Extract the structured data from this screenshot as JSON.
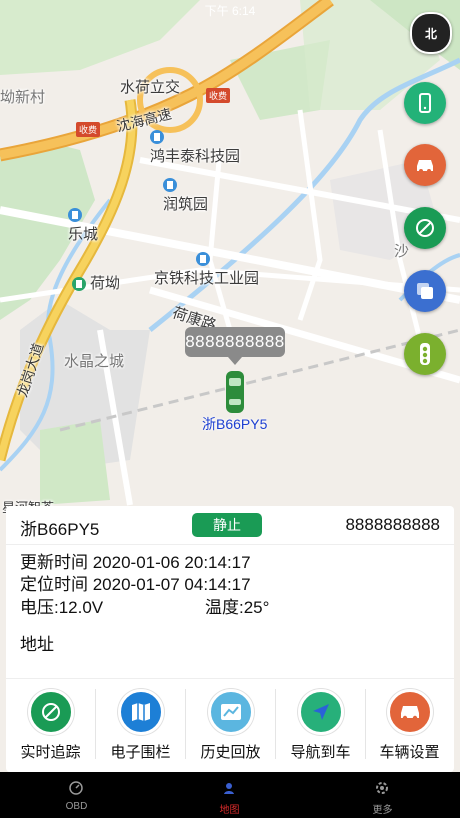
{
  "status_bar": {
    "time": "下午 6:14"
  },
  "map": {
    "labels": {
      "shuihe_interchange": "水荷立交",
      "shenhai_expressway": "沈海高速",
      "hongfengtai": "鸿丰泰科技园",
      "runzhuyuan": "润筑园",
      "lecheng": "乐城",
      "hegao": "荷坳",
      "jingtie": "京铁科技工业园",
      "hekang_road": "荷康路",
      "shuijing_city": "水晶之城",
      "longgang_avenue": "龙岗大道",
      "xincun": "坳新村",
      "sha": "沙",
      "toll1": "收费",
      "toll2": "收费",
      "bottom_poi": "星河智荟"
    },
    "compass_label": "北",
    "vehicle_bubble": "8888888888",
    "vehicle_plate_label": "浙B66PY5"
  },
  "side_buttons": [
    {
      "icon": "phone-icon",
      "color": "#23b278"
    },
    {
      "icon": "car-icon",
      "color": "#e2653a"
    },
    {
      "icon": "tracking-icon",
      "color": "#1a9b55"
    },
    {
      "icon": "layers-icon",
      "color": "#3b6fd0"
    },
    {
      "icon": "traffic-light-icon",
      "color": "#7bb02e"
    }
  ],
  "panel": {
    "plate": "浙B66PY5",
    "status": "静止",
    "phone": "8888888888",
    "update_time": "更新时间 2020-01-06 20:14:17",
    "locate_time": "定位时间 2020-01-07 04:14:17",
    "voltage": "电压:12.0V",
    "temperature": "温度:25°",
    "address": "地址"
  },
  "actions": [
    {
      "label": "实时追踪",
      "icon": "realtime-tracking-icon",
      "color": "#1a9b55"
    },
    {
      "label": "电子围栏",
      "icon": "geofence-map-icon",
      "color": "#1d7fd6"
    },
    {
      "label": "历史回放",
      "icon": "history-playback-icon",
      "color": "#5bb6e0"
    },
    {
      "label": "导航到车",
      "icon": "navigate-icon",
      "color": "#27b07a"
    },
    {
      "label": "车辆设置",
      "icon": "car-settings-icon",
      "color": "#e2653a"
    }
  ],
  "tabs": [
    {
      "label": "OBD",
      "icon": "obd-icon"
    },
    {
      "label": "地图",
      "icon": "map-icon",
      "active_color": "#d62a2a"
    },
    {
      "label": "更多",
      "icon": "more-icon"
    }
  ]
}
